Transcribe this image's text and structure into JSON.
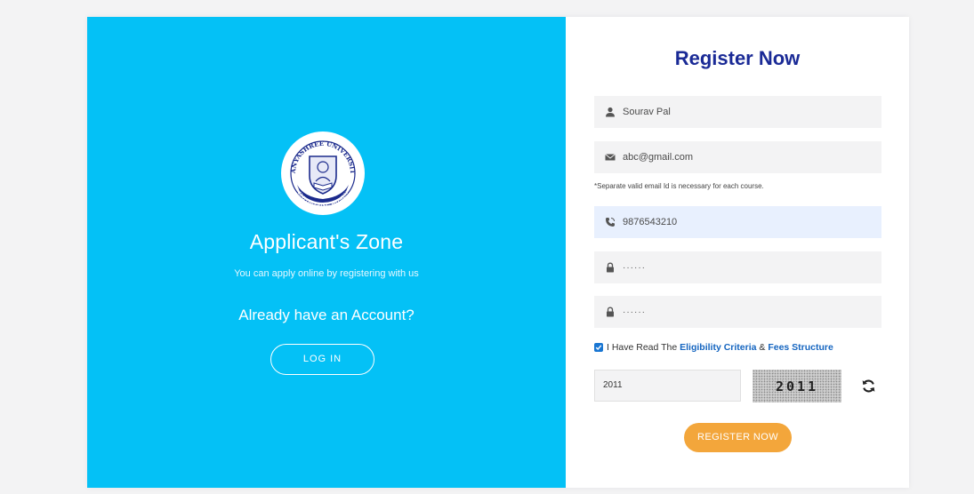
{
  "left_panel": {
    "logo_top_text": "KANYASHREE UNIVERSITY",
    "logo_bottom_text": "EMPOWERING WOMEN",
    "title": "Applicant's Zone",
    "subtitle": "You can apply online by registering with us",
    "already_text": "Already have an Account?",
    "login_label": "LOG IN"
  },
  "form": {
    "title": "Register Now",
    "name_value": "Sourav Pal",
    "email_value": "abc@gmail.com",
    "email_note": "*Separate valid email Id is necessary for each course.",
    "phone_value": "9876543210",
    "password_value": "······",
    "confirm_password_value": "······",
    "agree_checked": true,
    "agree_prefix": "I Have Read The",
    "eligibility_link": "Eligibility Criteria",
    "agree_and": "&",
    "fees_link": "Fees Structure",
    "captcha_input_value": "2011",
    "captcha_image_text": "2011",
    "register_label": "REGISTER NOW"
  },
  "colors": {
    "left_bg": "#04c1f6",
    "title_blue": "#1a2a96",
    "link_blue": "#1565c0",
    "register_orange": "#f3a63b",
    "active_field": "#e8f0fe"
  },
  "icons": {
    "name": "user-icon",
    "email": "envelope-icon",
    "phone": "phone-icon",
    "password": "lock-icon",
    "confirm_password": "lock-icon",
    "captcha_refresh": "refresh-icon"
  }
}
